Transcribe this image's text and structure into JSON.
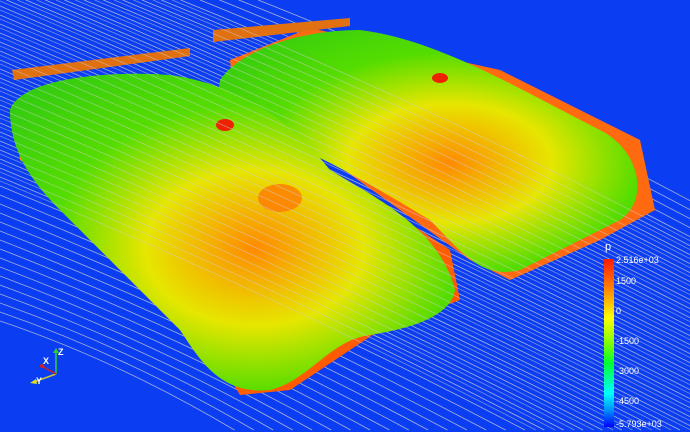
{
  "legend": {
    "title": "p",
    "max_label": "2.516e+03",
    "min_label": "-5.793e+03",
    "ticks": [
      "1500",
      "0",
      "-1500",
      "-3000",
      "-4500"
    ],
    "range": [
      -5793,
      2516
    ],
    "colors": [
      "#ff1a00",
      "#ff8000",
      "#ffff00",
      "#80ff00",
      "#00ff30",
      "#00ffff",
      "#0000ff"
    ]
  },
  "axes": {
    "x": "X",
    "y": "Y",
    "z": "Z"
  },
  "background_color": "#0b3ef2"
}
